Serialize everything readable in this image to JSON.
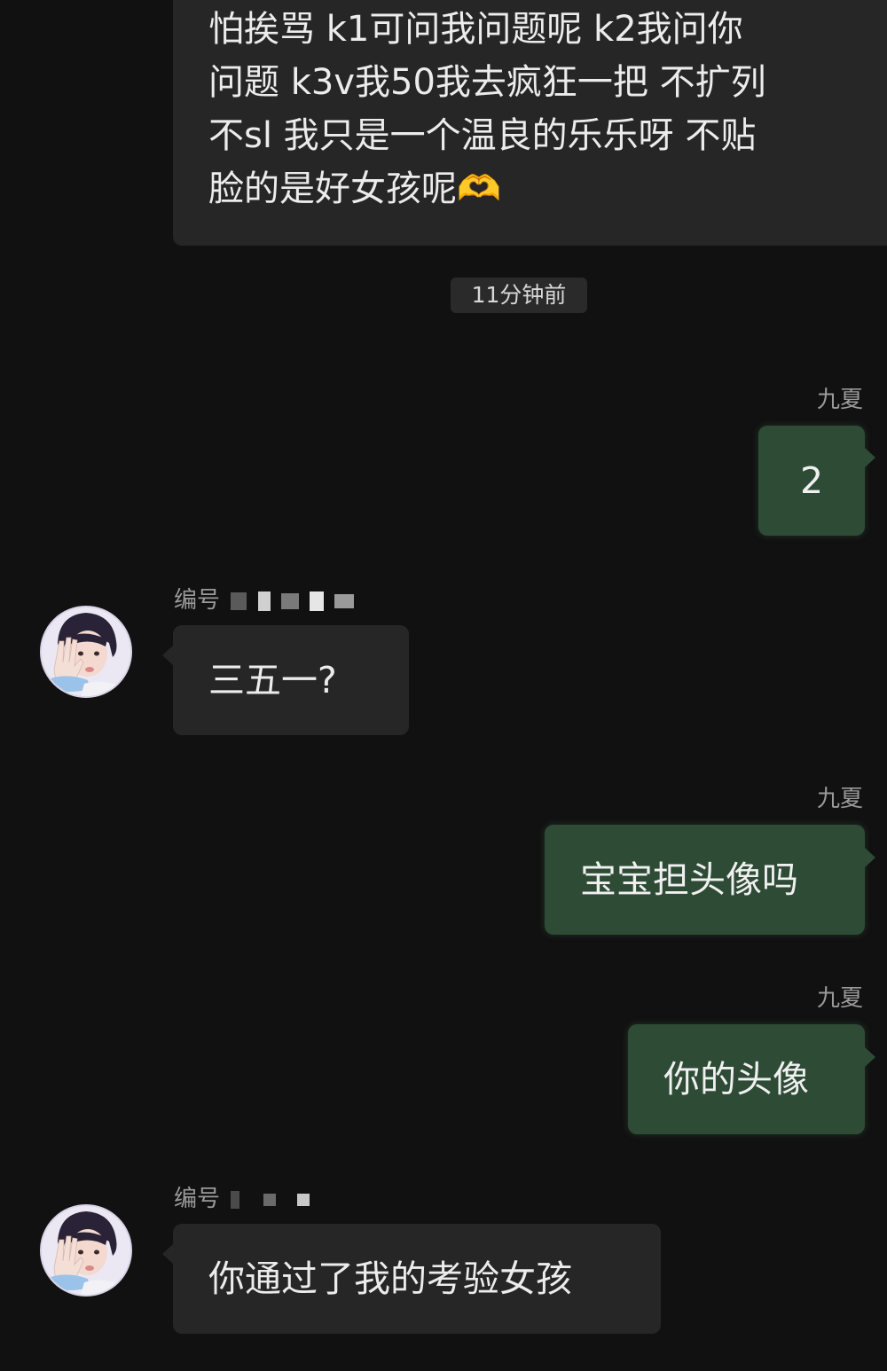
{
  "messages": {
    "first": {
      "lines": [
        "怕挨骂 k1可问我问题呢 k2我问你",
        "问题 k3v我50我去疯狂一把 不扩列",
        "不sl 我只是一个温良的乐乐呀 不贴",
        "脸的是好女孩呢🫶"
      ]
    },
    "timestamp": "11分钟前",
    "out1": {
      "sender": "九夏",
      "text": "2"
    },
    "in1": {
      "sender": "编号",
      "text": "三五一?"
    },
    "out2": {
      "sender": "九夏",
      "text": "宝宝担头像吗"
    },
    "out3": {
      "sender": "九夏",
      "text": "你的头像"
    },
    "in2": {
      "sender": "编号",
      "text": "你通过了我的考验女孩"
    }
  },
  "colors": {
    "background": "#111111",
    "incoming_bubble": "#262626",
    "outgoing_bubble": "#2e4b36"
  }
}
